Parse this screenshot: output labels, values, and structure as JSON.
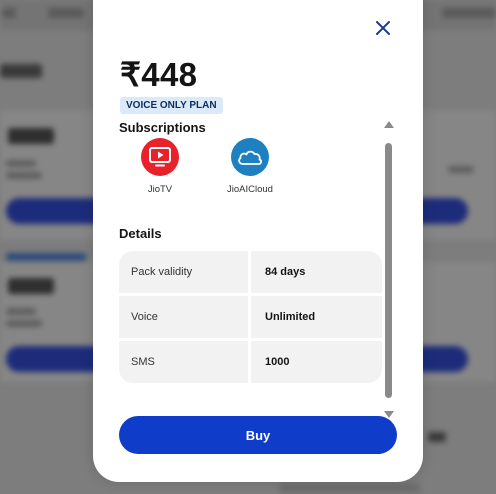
{
  "modal": {
    "price": "₹448",
    "plan_tag": "VOICE ONLY PLAN",
    "subscriptions_title": "Subscriptions",
    "subscriptions": [
      {
        "label": "JioTV",
        "icon": "jiotv-icon",
        "color": "#e8212a"
      },
      {
        "label": "JioAICloud",
        "icon": "jioaicloud-icon",
        "color": "#1e7fc1"
      }
    ],
    "details_title": "Details",
    "details": [
      {
        "key": "Pack validity",
        "value": "84 days"
      },
      {
        "key": "Voice",
        "value": "Unlimited"
      },
      {
        "key": "SMS",
        "value": "1000"
      }
    ],
    "buy_label": "Buy"
  },
  "colors": {
    "accent": "#0f3cc9",
    "tag_bg": "#dce9f8",
    "close_icon": "#1a3a8f"
  }
}
